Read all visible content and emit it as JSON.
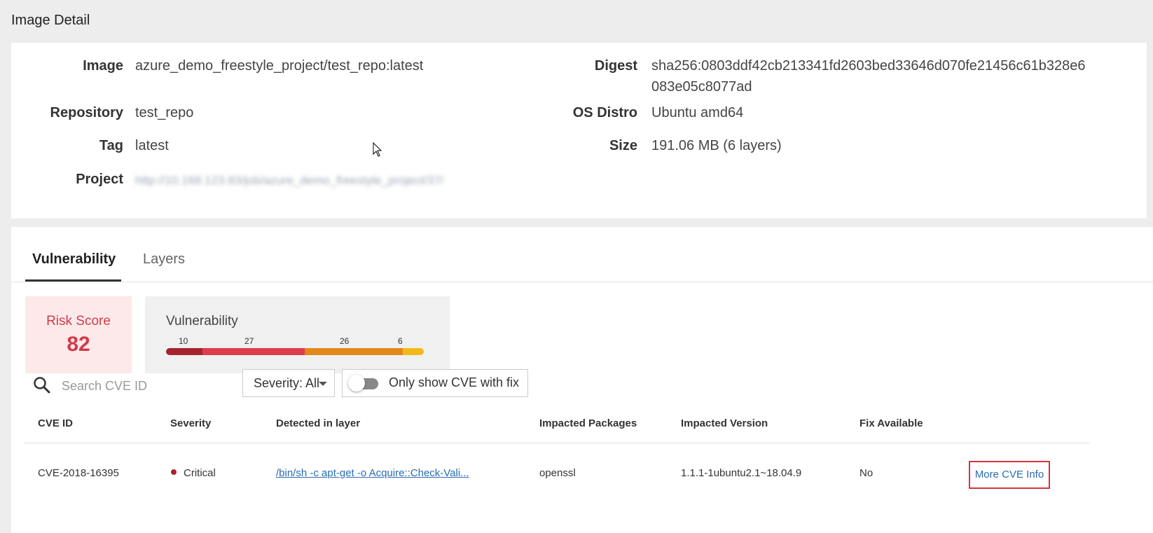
{
  "header": {
    "title": "Image Detail"
  },
  "details": {
    "image_label": "Image",
    "image_value": "azure_demo_freestyle_project/test_repo:latest",
    "repository_label": "Repository",
    "repository_value": "test_repo",
    "tag_label": "Tag",
    "tag_value": "latest",
    "project_label": "Project",
    "project_value": "http://10.168.123.83/job/azure_demo_freestyle_project/37/",
    "digest_label": "Digest",
    "digest_value_line1": "sha256:0803ddf42cb213341fd2603bed33646d070fe21456c61b328e6",
    "digest_value_line2": "083e05c8077ad",
    "os_label": "OS Distro",
    "os_value": "Ubuntu amd64",
    "size_label": "Size",
    "size_value": "191.06 MB (6 layers)"
  },
  "tabs": [
    {
      "label": "Vulnerability",
      "active": true
    },
    {
      "label": "Layers",
      "active": false
    }
  ],
  "risk": {
    "label": "Risk Score",
    "value": "82",
    "color": "#d13b4a"
  },
  "vulnerability_summary": {
    "title": "Vulnerability",
    "counts": [
      {
        "severity": "critical",
        "count": "10",
        "color": "#a5242d"
      },
      {
        "severity": "high",
        "count": "27",
        "color": "#de3c4b"
      },
      {
        "severity": "medium",
        "count": "26",
        "color": "#e0891a"
      },
      {
        "severity": "low",
        "count": "6",
        "color": "#f2b91b"
      }
    ]
  },
  "filters": {
    "search_placeholder": "Search CVE ID",
    "search_icon": "search-icon",
    "severity_label": "Severity: All",
    "fix_toggle_label": "Only show CVE with fix",
    "fix_toggle_on": false
  },
  "table": {
    "columns": [
      "CVE ID",
      "Severity",
      "Detected in layer",
      "Impacted Packages",
      "Impacted Version",
      "Fix Available"
    ],
    "rows": [
      {
        "cve_id": "CVE-2018-16395",
        "severity": "Critical",
        "layer": "/bin/sh -c apt-get -o Acquire::Check-Vali...",
        "package": "openssl",
        "version": "1.1.1-1ubuntu2.1~18.04.9",
        "fix": "No",
        "action": "More CVE Info"
      }
    ]
  }
}
